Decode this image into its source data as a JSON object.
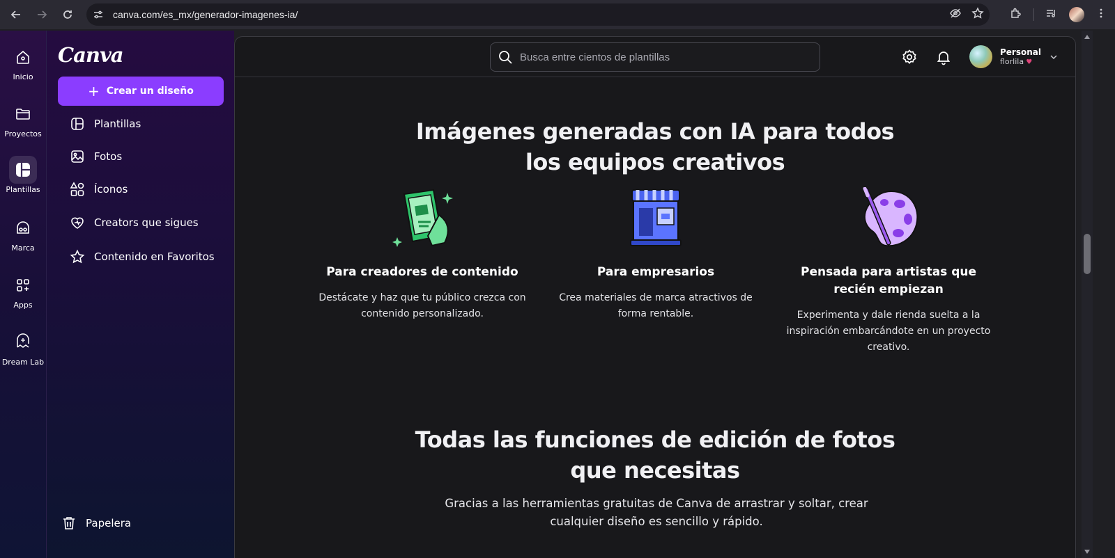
{
  "browser": {
    "url": "canva.com/es_mx/generador-imagenes-ia/"
  },
  "rail": {
    "items": [
      {
        "label": "Inicio",
        "icon": "home-icon"
      },
      {
        "label": "Proyectos",
        "icon": "folder-icon"
      },
      {
        "label": "Plantillas",
        "icon": "templates-icon",
        "active": true
      },
      {
        "label": "Marca",
        "icon": "brand-icon"
      },
      {
        "label": "Apps",
        "icon": "apps-icon"
      },
      {
        "label": "Dream Lab",
        "icon": "dream-lab-icon"
      }
    ]
  },
  "panel": {
    "logo": "Canva",
    "create_label": "Crear un diseño",
    "menu": [
      {
        "label": "Plantillas",
        "icon": "template-icon"
      },
      {
        "label": "Fotos",
        "icon": "photo-icon"
      },
      {
        "label": "Íconos",
        "icon": "shapes-icon"
      },
      {
        "label": "Creators que sigues",
        "icon": "heart-icon"
      },
      {
        "label": "Contenido en Favoritos",
        "icon": "star-icon"
      }
    ],
    "trash_label": "Papelera"
  },
  "topbar": {
    "search_placeholder": "Busca entre cientos de plantillas",
    "account_name": "Personal",
    "account_user": "florlila"
  },
  "section1": {
    "title_line1": "Imágenes generadas con IA para todos",
    "title_line2": "los equipos creativos",
    "features": [
      {
        "title": "Para creadores de contenido",
        "desc": "Destácate y haz que tu público crezca con contenido personalizado.",
        "icon": "phone-icon"
      },
      {
        "title": "Para empresarios",
        "desc": "Crea materiales de marca atractivos de forma rentable.",
        "icon": "storefront-icon"
      },
      {
        "title": "Pensada para artistas que recién empiezan",
        "desc": "Experimenta y dale rienda suelta a la inspiración embarcándote en un proyecto creativo.",
        "icon": "palette-icon"
      }
    ]
  },
  "section2": {
    "title_line1": "Todas las funciones de edición de fotos",
    "title_line2": "que necesitas",
    "subtitle": "Gracias a las herramientas gratuitas de Canva de arrastrar y soltar, crear cualquier diseño es sencillo y rápido."
  },
  "colors": {
    "accent": "#8b3dff",
    "main_bg": "#18181b"
  }
}
